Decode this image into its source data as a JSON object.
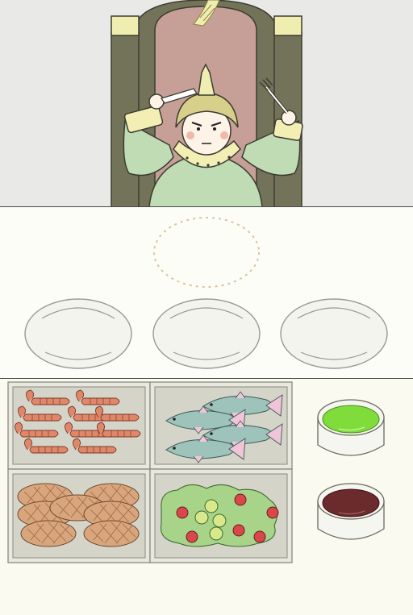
{
  "colors": {
    "wall": "#e9e9e8",
    "table": "#fdfdf8",
    "tray_bg": "#fbfaf0",
    "throne_dark": "#73735a",
    "throne_panel": "#c69f97",
    "throne_cap": "#f0edb0",
    "robe": "#bfdcb5",
    "collar": "#f3eeb4",
    "hair": "#d6d08a",
    "green_sauce": "#7fdc3a",
    "red_sauce": "#6b2a2c",
    "lobster": "#e0876a",
    "fish": "#9ec3bb",
    "fish_fin": "#f0c4d9",
    "steak": "#d9a57c",
    "lettuce": "#a8d48a",
    "tomato": "#d8474a"
  },
  "scene": {
    "character": "king-character",
    "held_left": "knife-icon",
    "held_right": "fork-icon",
    "crest": "wing-emblem-icon"
  },
  "table": {
    "request_slot": "dotted-plate-target",
    "plates": [
      "plate-left",
      "plate-center",
      "plate-right"
    ]
  },
  "tray": {
    "foods": [
      {
        "id": "lobster",
        "icon": "lobster-icon"
      },
      {
        "id": "fish",
        "icon": "fish-icon"
      },
      {
        "id": "steak",
        "icon": "steak-icon"
      },
      {
        "id": "salad",
        "icon": "salad-icon"
      }
    ],
    "sauces": [
      {
        "id": "green-sauce",
        "icon": "green-sauce-bowl-icon"
      },
      {
        "id": "red-sauce",
        "icon": "red-sauce-bowl-icon"
      }
    ]
  }
}
